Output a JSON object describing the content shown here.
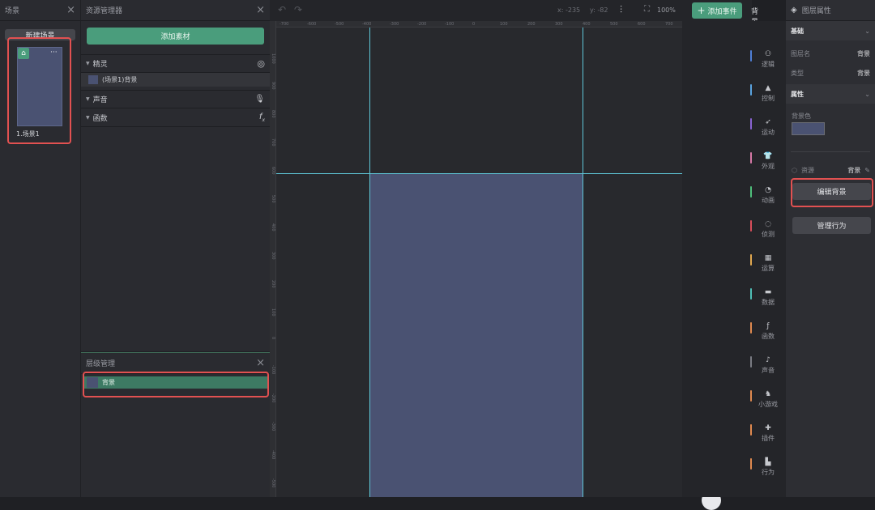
{
  "scene_panel": {
    "title": "场景",
    "new_scene_label": "新建场景",
    "thumb_label": "1.场景1",
    "more": "···"
  },
  "assets_panel": {
    "title": "资源管理器",
    "add_label": "添加素材",
    "sections": [
      {
        "label": "精灵",
        "icon": "palette-icon"
      },
      {
        "label": "声音",
        "icon": "mic-icon"
      },
      {
        "label": "函数",
        "icon": "fx-icon"
      }
    ],
    "sprite_item": "(场景1)背景"
  },
  "layers_panel": {
    "title": "层级管理",
    "item": "背景"
  },
  "toolbar": {
    "coords_x": "x: -235",
    "coords_y": "y: -82",
    "zoom": "100%",
    "add_event": "添加事件",
    "current_target": "背景"
  },
  "ruler": {
    "h_ticks": [
      "-700",
      "-600",
      "-500",
      "-400",
      "-300",
      "-200",
      "-100",
      "0",
      "100",
      "200",
      "300",
      "400",
      "500",
      "600",
      "700"
    ],
    "v_ticks": [
      "1000",
      "900",
      "800",
      "700",
      "600",
      "500",
      "400",
      "300",
      "200",
      "100",
      "0",
      "-100",
      "-200",
      "-300",
      "-400",
      "-500"
    ]
  },
  "categories": [
    {
      "label": "逻辑",
      "icon": "logic-icon",
      "color": "#4f7fd6"
    },
    {
      "label": "控制",
      "icon": "control-icon",
      "color": "#5aa3e0"
    },
    {
      "label": "运动",
      "icon": "motion-icon",
      "color": "#8a63d2"
    },
    {
      "label": "外观",
      "icon": "shirt-icon",
      "color": "#d779a6"
    },
    {
      "label": "动画",
      "icon": "animation-icon",
      "color": "#4fbf7b"
    },
    {
      "label": "侦测",
      "icon": "detect-icon",
      "color": "#d94e5a"
    },
    {
      "label": "运算",
      "icon": "grid-icon",
      "color": "#e0a84f"
    },
    {
      "label": "数据",
      "icon": "data-icon",
      "color": "#4fbfb6"
    },
    {
      "label": "函数",
      "icon": "fx-icon",
      "color": "#e08a4f"
    },
    {
      "label": "声音",
      "icon": "mic-icon",
      "color": "#7a7c83"
    },
    {
      "label": "小游戏",
      "icon": "game-icon",
      "color": "#e08a4f"
    },
    {
      "label": "插件",
      "icon": "plugin-icon",
      "color": "#e08a4f"
    },
    {
      "label": "行为",
      "icon": "behavior-icon",
      "color": "#e08a4f"
    }
  ],
  "props_panel": {
    "title": "图层属性",
    "basic": "基础",
    "layer_name_label": "图层名",
    "layer_name_value": "背景",
    "type_label": "类型",
    "type_value": "背景",
    "attr": "属性",
    "bg_color_label": "背景色",
    "bg_color": "#4a5272",
    "resource_label": "资源",
    "resource_value": "背景",
    "edit_bg": "编辑背景",
    "manage_behavior": "管理行为"
  },
  "colors": {
    "accent": "#4a9d7c",
    "stage": "#4a5272",
    "highlight": "#e25151"
  }
}
